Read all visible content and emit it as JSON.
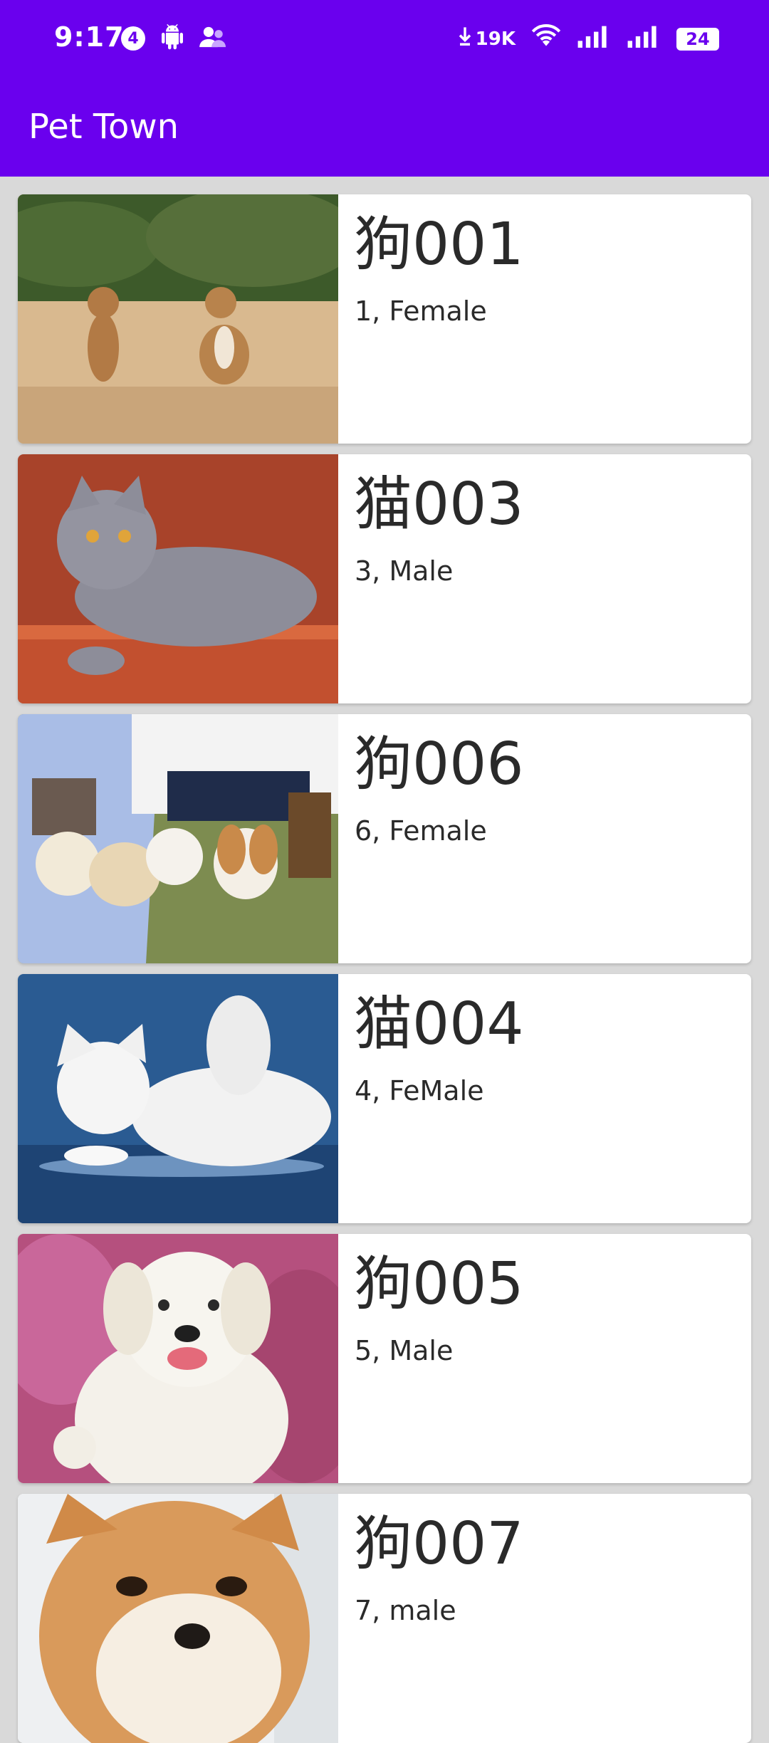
{
  "status_bar": {
    "time": "9:17",
    "notification_count": "4",
    "net_speed": "19K",
    "battery": "24",
    "icons": [
      "android-icon",
      "person-icon",
      "download-icon",
      "wifi-icon",
      "signal-icon",
      "signal-icon-2",
      "battery-icon"
    ]
  },
  "app_bar": {
    "title": "Pet Town",
    "color": "#6a00ee"
  },
  "pets": [
    {
      "name": "狗001",
      "desc": "1, Female",
      "photo": "two-dogs-on-sand"
    },
    {
      "name": "猫003",
      "desc": "3, Male",
      "photo": "grey-cat-on-orange"
    },
    {
      "name": "狗006",
      "desc": "6, Female",
      "photo": "puppies-on-picnic-blanket"
    },
    {
      "name": "猫004",
      "desc": "4, FeMale",
      "photo": "white-kitten-on-blue"
    },
    {
      "name": "狗005",
      "desc": "5, Male",
      "photo": "white-dog-in-flowers"
    },
    {
      "name": "狗007",
      "desc": "7, male",
      "photo": "shiba-inu"
    }
  ]
}
